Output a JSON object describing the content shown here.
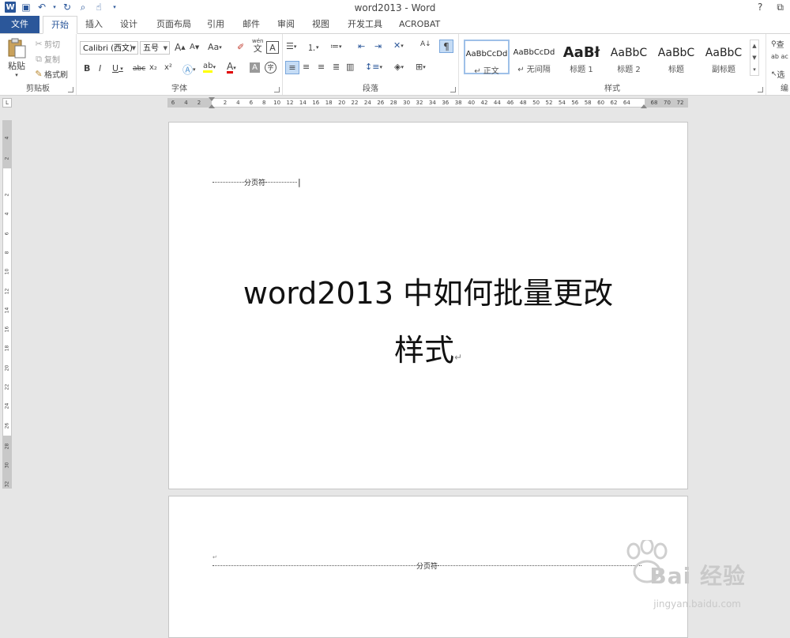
{
  "window": {
    "title": "word2013 - Word",
    "help": "?",
    "restore": "⧉"
  },
  "tabs": {
    "file": "文件",
    "home": "开始",
    "insert": "插入",
    "design": "设计",
    "layout": "页面布局",
    "references": "引用",
    "mailings": "邮件",
    "review": "审阅",
    "view": "视图",
    "developer": "开发工具",
    "acrobat": "ACROBAT"
  },
  "clipboard": {
    "paste": "粘贴",
    "cut": "剪切",
    "copy": "复制",
    "format_painter": "格式刷",
    "label": "剪贴板"
  },
  "font": {
    "name": "Calibri (西文)",
    "size": "五号",
    "grow": "A",
    "shrink": "A",
    "case": "Aa",
    "pinyin_top": "wén",
    "pinyin_char": "文",
    "border_char": "A",
    "bold": "B",
    "italic": "I",
    "underline": "U",
    "strike": "abc",
    "subscript": "x₂",
    "superscript": "x²",
    "label": "字体"
  },
  "paragraph": {
    "label": "段落"
  },
  "styles": {
    "label": "样式",
    "items": [
      {
        "sample": "AaBbCcDd",
        "name": "↵ 正文"
      },
      {
        "sample": "AaBbCcDd",
        "name": "↵ 无间隔"
      },
      {
        "sample": "AaBł",
        "name": "标题 1"
      },
      {
        "sample": "AaBbC",
        "name": "标题 2"
      },
      {
        "sample": "AaBbC",
        "name": "标题"
      },
      {
        "sample": "AaBbC",
        "name": "副标题"
      }
    ]
  },
  "editing": {
    "find": "查",
    "replace": "ab ac",
    "select": "选",
    "label": "编"
  },
  "ruler": {
    "corner": "L",
    "h_left": [
      "6",
      "4",
      "2"
    ],
    "h_main": [
      "2",
      "4",
      "6",
      "8",
      "10",
      "12",
      "14",
      "16",
      "18",
      "20",
      "22",
      "24",
      "26",
      "28",
      "30",
      "32",
      "34",
      "36",
      "38",
      "40",
      "42",
      "44",
      "46",
      "48",
      "50",
      "52",
      "54",
      "56",
      "58",
      "60",
      "62",
      "64"
    ],
    "h_right": [
      "68",
      "70",
      "72"
    ],
    "v_top": [
      "4",
      "2"
    ],
    "v_main": [
      "2",
      "4",
      "6",
      "8",
      "10",
      "12",
      "14",
      "16",
      "18",
      "20",
      "22",
      "24",
      "26"
    ],
    "v_bottom": [
      "28",
      "30",
      "32"
    ]
  },
  "document": {
    "page_break": "分页符",
    "title_line1": "word2013 中如何批量更改",
    "title_line2": "样式",
    "para_mark": "↵"
  },
  "watermark": {
    "brand": "Bai 经验",
    "url": "jingyan.baidu.com"
  }
}
